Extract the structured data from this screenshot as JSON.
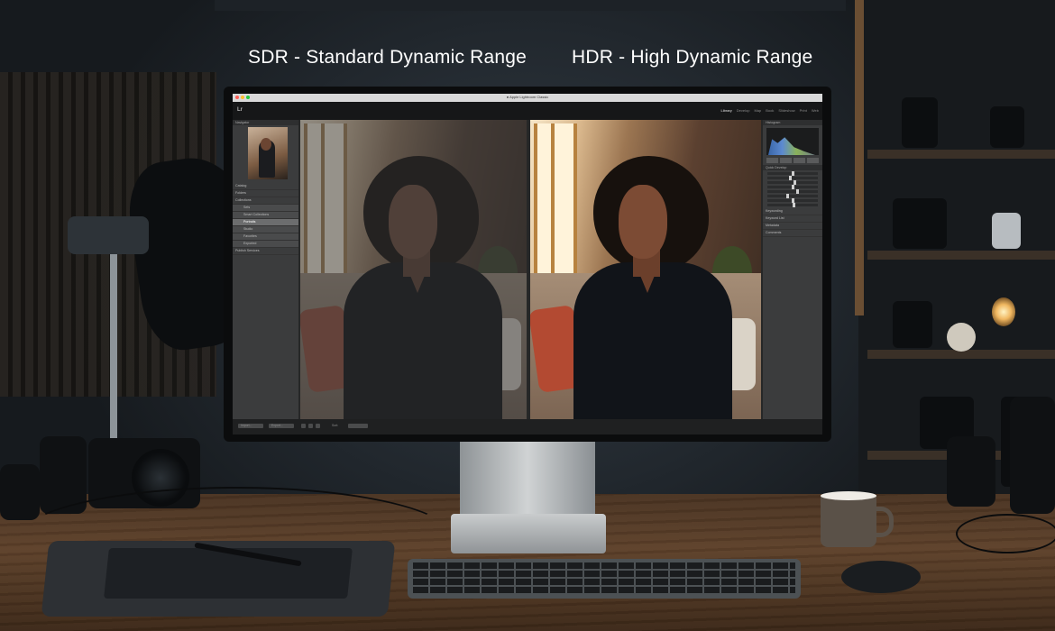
{
  "headlines": {
    "sdr": "SDR - Standard Dynamic Range",
    "hdr": "HDR - High Dynamic Range"
  },
  "app": {
    "logo": "Lr",
    "window_title": "● Apple Lightroom Classic",
    "modules": [
      "Library",
      "Develop",
      "Map",
      "Book",
      "Slideshow",
      "Print",
      "Web"
    ],
    "active_module": "Library"
  },
  "left_panel": {
    "navigator_label": "Navigator",
    "sections": [
      "Catalog",
      "Folders",
      "Collections",
      "Publish Services"
    ],
    "sub_items": [
      "Sets",
      "Smart Collections",
      "Portraits",
      "Studio",
      "Favorites",
      "Exported"
    ],
    "selected_sub_item_index": 2
  },
  "right_panel": {
    "histogram_label": "Histogram",
    "quick_develop_label": "Quick Develop",
    "sections": [
      "Keywording",
      "Keyword List",
      "Metadata",
      "Comments"
    ]
  },
  "bottom_bar": {
    "import_label": "Import...",
    "export_label": "Export...",
    "sort_label": "Sort:"
  },
  "colors": {
    "mac_close": "#ff5f56",
    "mac_min": "#ffbd2e",
    "mac_max": "#27c93f",
    "headline": "#ffffff"
  },
  "slider_levels": [
    0.5,
    0.45,
    0.55,
    0.5,
    0.6,
    0.4,
    0.5,
    0.52
  ]
}
